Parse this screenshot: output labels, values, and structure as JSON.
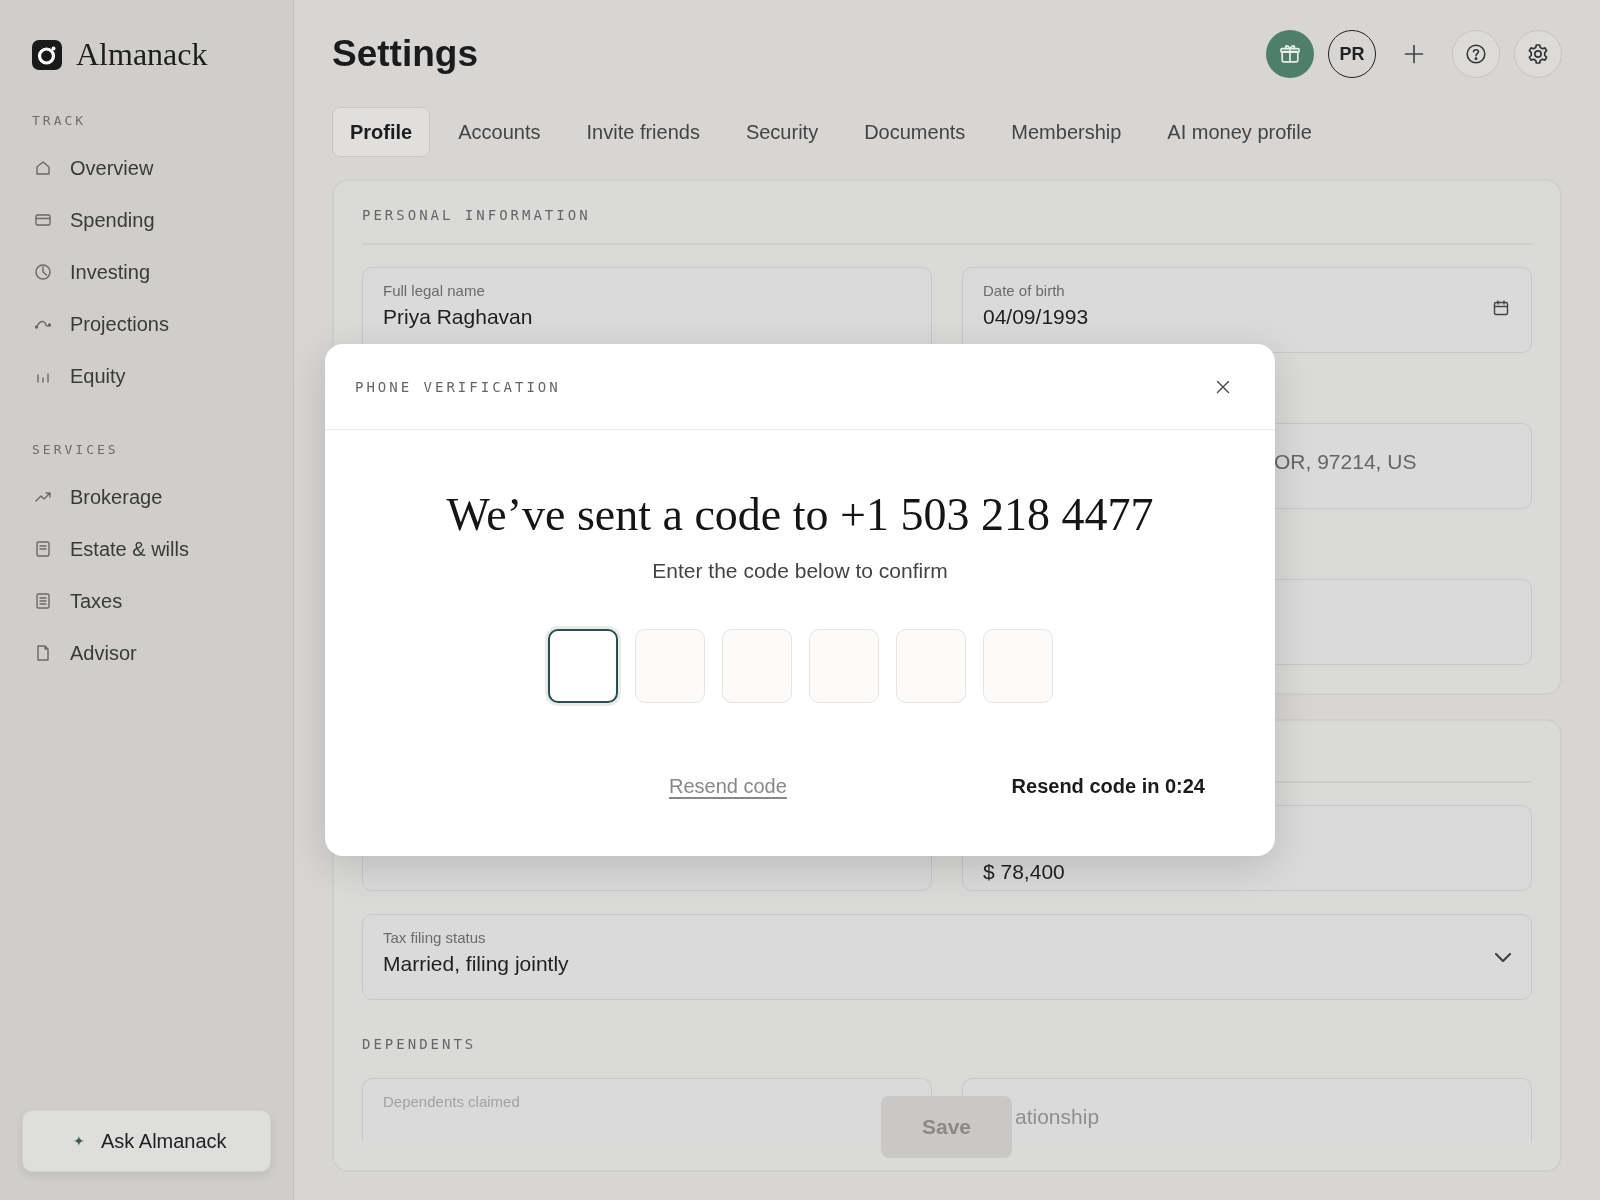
{
  "sidebar": {
    "brand": "Almanack",
    "sections": [
      {
        "title": "TRACK",
        "items": [
          {
            "label": "Overview"
          },
          {
            "label": "Spending"
          },
          {
            "label": "Investing"
          },
          {
            "label": "Projections"
          },
          {
            "label": "Equity"
          }
        ]
      },
      {
        "title": "SERVICES",
        "items": [
          {
            "label": "Brokerage"
          },
          {
            "label": "Estate & wills"
          },
          {
            "label": "Taxes"
          },
          {
            "label": "Advisor"
          }
        ]
      }
    ],
    "ask_button": {
      "label": "Ask Almanack",
      "icon": "✦"
    }
  },
  "header": {
    "title": "Settings",
    "avatar": "PR"
  },
  "tabs": [
    {
      "label": "Profile",
      "selected": true
    },
    {
      "label": "Accounts",
      "selected": false
    },
    {
      "label": "Invite friends",
      "selected": false
    },
    {
      "label": "Security",
      "selected": false
    },
    {
      "label": "Documents",
      "selected": false
    },
    {
      "label": "Membership",
      "selected": false
    },
    {
      "label": "AI money profile",
      "selected": false
    }
  ],
  "personal_information": {
    "title": "PERSONAL INFORMATION",
    "rows": [
      [
        {
          "kind": "text",
          "label": "Full legal name",
          "value": "Priya Raghavan"
        },
        {
          "kind": "date",
          "label": "Date of birth",
          "value": "04/09/1993"
        }
      ],
      [
        {
          "kind": "text",
          "value": "OR, 97214, US"
        }
      ],
      [
        {
          "kind": "text"
        }
      ]
    ]
  },
  "employment": {
    "rows": [
      [
        {
          "kind": "text"
        },
        {
          "kind": "text",
          "value": "$ 78,400"
        }
      ],
      [
        {
          "kind": "select",
          "label": "Tax filing status",
          "value": "Married, filing jointly"
        }
      ]
    ],
    "dependents": {
      "title": "DEPENDENTS",
      "rows": [
        [
          {
            "kind": "text",
            "label": "Dependents claimed"
          },
          {
            "kind": "text",
            "placeholder": "ationship"
          }
        ]
      ]
    }
  },
  "save_button": {
    "label": "Save",
    "disabled": true
  },
  "dialog": {
    "title": "PHONE VERIFICATION",
    "heading": "We’ve sent a code to +1 503 218 4477",
    "subtitle": "Enter the code below to confirm",
    "code_boxes": [
      {
        "selected": true
      },
      {
        "selected": false
      },
      {
        "selected": false
      },
      {
        "selected": false
      },
      {
        "selected": false
      },
      {
        "selected": false
      }
    ],
    "resend_link": "Resend code",
    "countdown": "Resend code in 0:24"
  }
}
